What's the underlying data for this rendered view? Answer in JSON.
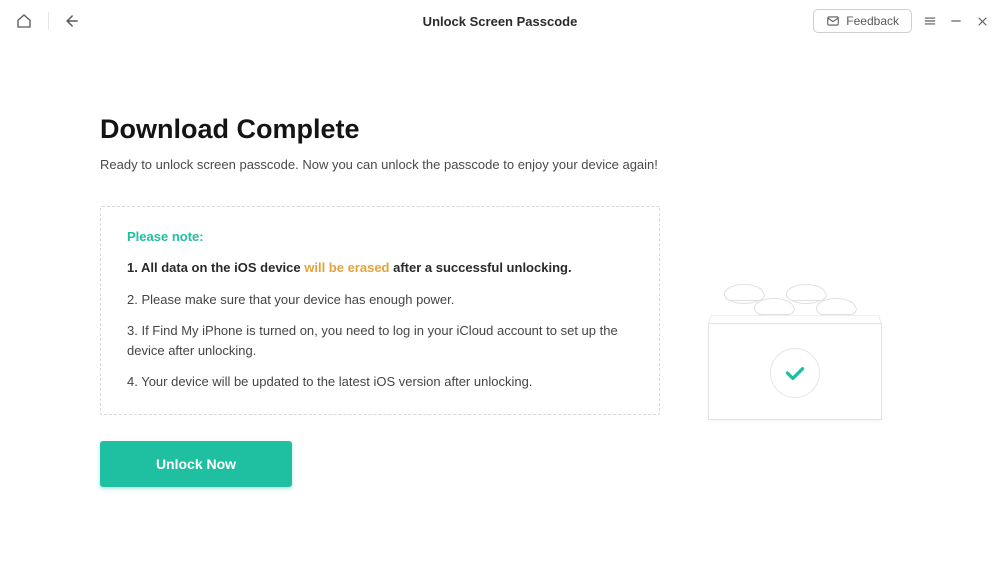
{
  "header": {
    "title": "Unlock Screen Passcode",
    "feedback_label": "Feedback"
  },
  "page": {
    "title": "Download Complete",
    "subtitle": "Ready to unlock screen passcode. Now you can unlock the passcode to enjoy your device again!"
  },
  "note": {
    "header": "Please note:",
    "line1_prefix": "1. All data on the iOS device ",
    "line1_highlight": "will be erased",
    "line1_suffix": " after a successful unlocking.",
    "line2": "2. Please make sure that your device has enough power.",
    "line3": "3. If Find My iPhone is turned on, you need to log in your iCloud account to set up the device after unlocking.",
    "line4": "4. Your device will be updated to the latest iOS version after unlocking."
  },
  "actions": {
    "unlock_label": "Unlock Now"
  }
}
